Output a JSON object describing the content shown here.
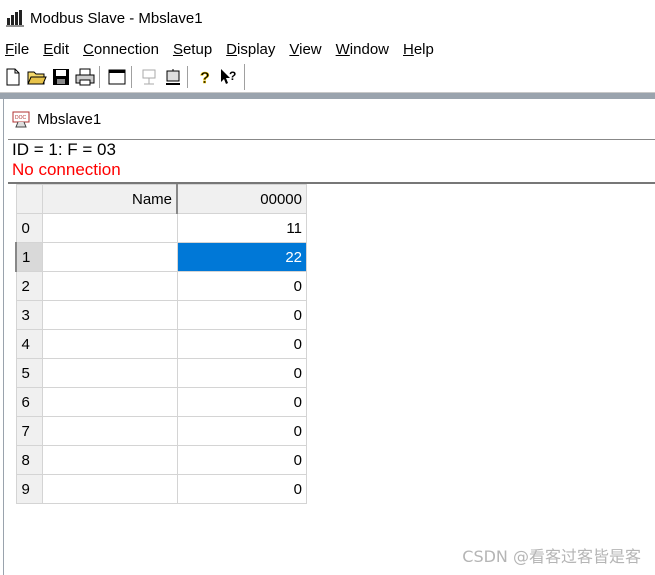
{
  "window": {
    "title": "Modbus Slave - Mbslave1"
  },
  "menu": [
    {
      "label": "File",
      "mnemonic_index": 0
    },
    {
      "label": "Edit",
      "mnemonic_index": 0
    },
    {
      "label": "Connection",
      "mnemonic_index": 0
    },
    {
      "label": "Setup",
      "mnemonic_index": 0
    },
    {
      "label": "Display",
      "mnemonic_index": 0
    },
    {
      "label": "View",
      "mnemonic_index": 0
    },
    {
      "label": "Window",
      "mnemonic_index": 0
    },
    {
      "label": "Help",
      "mnemonic_index": 0
    }
  ],
  "toolbar": {
    "buttons": [
      "new-file-icon",
      "open-folder-icon",
      "save-disk-icon",
      "print-icon",
      "window-icon",
      "connect-icon",
      "disconnect-icon",
      "help-icon",
      "context-help-icon"
    ]
  },
  "child": {
    "title": "Mbslave1",
    "id_line": "ID = 1: F = 03",
    "status": "No connection",
    "status_color": "#ff0000"
  },
  "grid": {
    "name_header": "Name",
    "address_header": "00000",
    "rows": [
      {
        "index": "0",
        "name": "",
        "value": "11"
      },
      {
        "index": "1",
        "name": "",
        "value": "22",
        "selected": true
      },
      {
        "index": "2",
        "name": "",
        "value": "0"
      },
      {
        "index": "3",
        "name": "",
        "value": "0"
      },
      {
        "index": "4",
        "name": "",
        "value": "0"
      },
      {
        "index": "5",
        "name": "",
        "value": "0"
      },
      {
        "index": "6",
        "name": "",
        "value": "0"
      },
      {
        "index": "7",
        "name": "",
        "value": "0"
      },
      {
        "index": "8",
        "name": "",
        "value": "0"
      },
      {
        "index": "9",
        "name": "",
        "value": "0"
      }
    ],
    "selected_color": "#0078d7"
  },
  "watermark": "CSDN @看客过客皆是客"
}
